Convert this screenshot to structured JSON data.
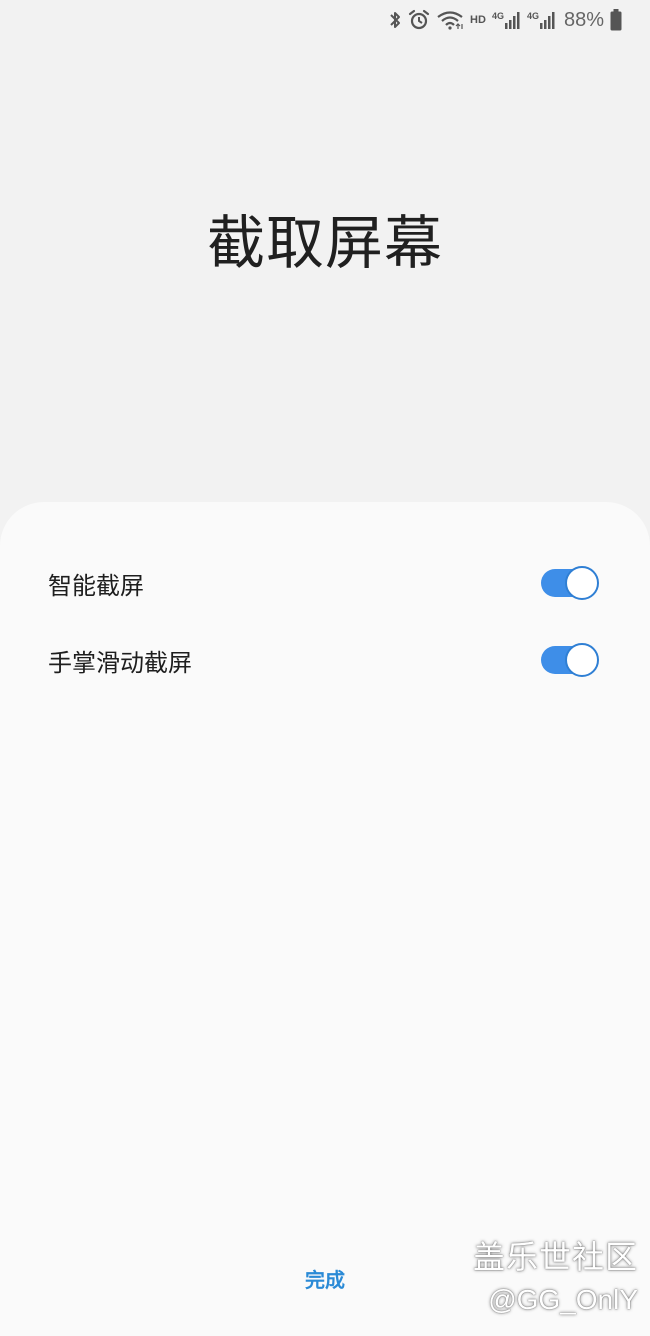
{
  "status_bar": {
    "icons": [
      "bluetooth-icon",
      "alarm-icon",
      "wifi-icon",
      "hd-icon",
      "signal-icon",
      "signal-icon",
      "battery-icon"
    ],
    "hd_label": "HD",
    "network_label_1": "4G",
    "network_label_2": "4G",
    "battery_text": "88%"
  },
  "page": {
    "title": "截取屏幕"
  },
  "settings": {
    "items": [
      {
        "label": "智能截屏",
        "enabled": true
      },
      {
        "label": "手掌滑动截屏",
        "enabled": true
      }
    ],
    "toggle_color": "#3e8ee8"
  },
  "footer": {
    "done_label": "完成",
    "done_color": "#2a8ad6"
  },
  "watermark": {
    "line1": "盖乐世社区",
    "line2": "@GG_OnlY"
  }
}
